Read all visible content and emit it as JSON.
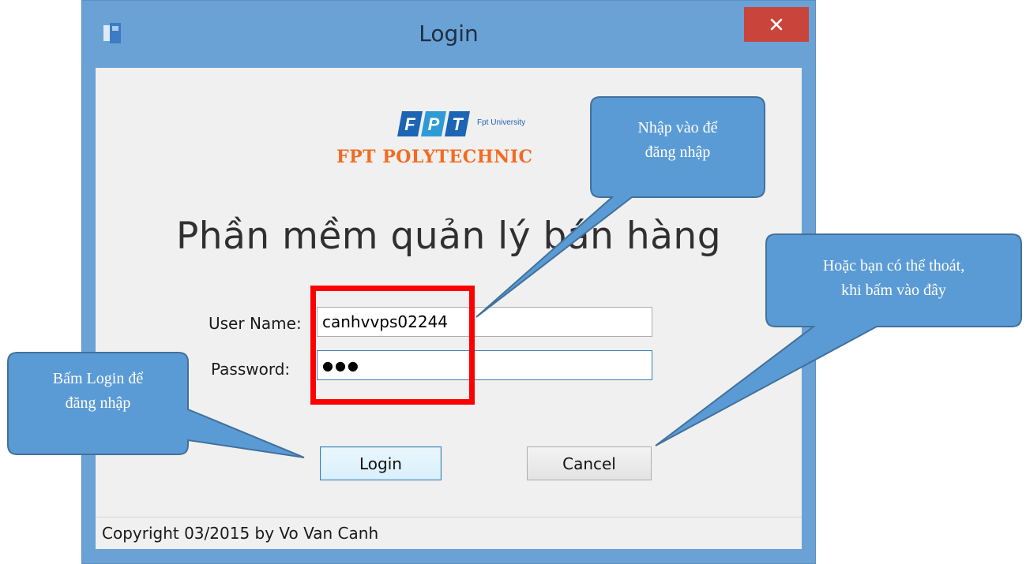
{
  "window": {
    "title": "Login",
    "icons": {
      "app": "app-window-icon",
      "close": "close-icon"
    }
  },
  "logo": {
    "brand": "FPT",
    "university": "Fpt University",
    "polytechnic": "FPT POLYTECHNIC"
  },
  "heading": "Phần mềm quản lý bán hàng",
  "form": {
    "username_label": "User Name:",
    "username_value": "canhvvps02244",
    "password_label": "Password:",
    "password_masked": "●●●"
  },
  "buttons": {
    "login": "Login",
    "cancel": "Cancel"
  },
  "status": {
    "copyright": "Copyright 03/2015 by Vo Van Canh"
  },
  "annotations": {
    "enter_to_login": [
      "Nhập vào để",
      "đăng nhập"
    ],
    "or_exit": [
      "Hoặc bạn có thể thoát,",
      "khi bấm vào đây"
    ],
    "press_login": [
      "Bấm Login để",
      "đăng nhập"
    ]
  },
  "colors": {
    "window_frame": "#6aa2d6",
    "close_button": "#c9443a",
    "logo_orange": "#f26b21",
    "logo_blue": "#1c64b4",
    "callout_fill": "#5b9bd5",
    "callout_border": "#41719c",
    "highlight_box": "#ff0000"
  }
}
